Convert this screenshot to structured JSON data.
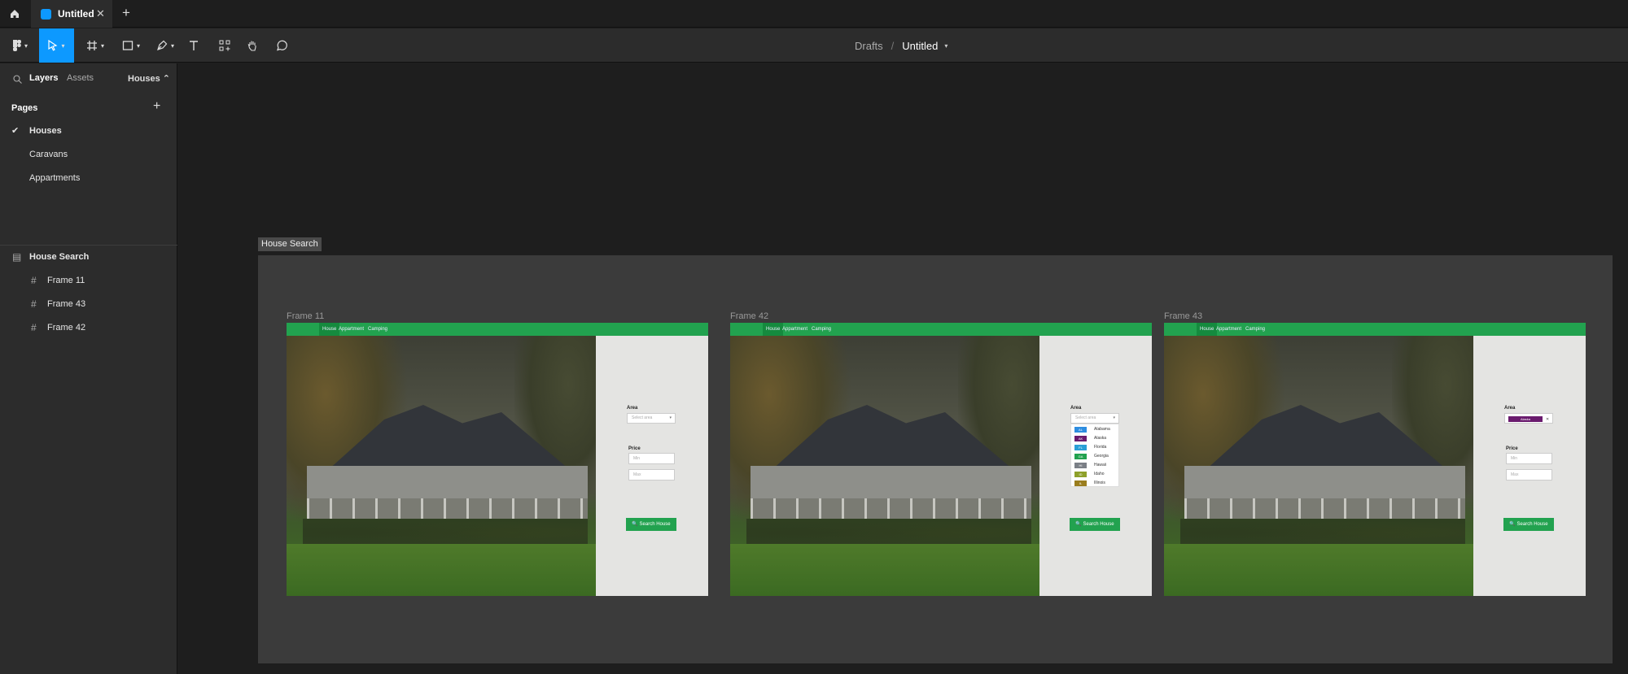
{
  "tabbar": {
    "tab_title": "Untitled",
    "close": "✕",
    "add": "+"
  },
  "toolbar": {
    "breadcrumb_root": "Drafts",
    "breadcrumb_sep": "/",
    "file_name": "Untitled"
  },
  "left_panel": {
    "tabs": {
      "layers": "Layers",
      "assets": "Assets",
      "page_switch": "Houses ⌃"
    },
    "pages_title": "Pages",
    "pages": [
      {
        "label": "Houses",
        "selected": true
      },
      {
        "label": "Caravans",
        "selected": false
      },
      {
        "label": "Appartments",
        "selected": false
      }
    ],
    "layers": [
      {
        "label": "House Search",
        "level": 0
      },
      {
        "label": "Frame 11",
        "level": 1
      },
      {
        "label": "Frame 43",
        "level": 1
      },
      {
        "label": "Frame 42",
        "level": 1
      }
    ]
  },
  "canvas": {
    "section_label": "House Search",
    "frames": [
      {
        "label": "Frame 11",
        "variant": "default"
      },
      {
        "label": "Frame 42",
        "variant": "dropdown"
      },
      {
        "label": "Frame 43",
        "variant": "selected"
      }
    ],
    "nav": [
      "House",
      "Appartment",
      "Camping"
    ],
    "form": {
      "area_label": "Area",
      "area_placeholder": "Select area",
      "price_label": "Price",
      "min_placeholder": "Min",
      "max_placeholder": "Max",
      "search_button": "🔍 Search House",
      "selected_area": "Alaska"
    },
    "area_options": [
      {
        "code": "AL",
        "name": "Alabama",
        "color": "#2d8de0"
      },
      {
        "code": "AK",
        "name": "Alaska",
        "color": "#6a1b6e"
      },
      {
        "code": "FL",
        "name": "Florida",
        "color": "#2a9fd6"
      },
      {
        "code": "GA",
        "name": "Georgia",
        "color": "#22a24f"
      },
      {
        "code": "HI",
        "name": "Hawaii",
        "color": "#7a7f86"
      },
      {
        "code": "ID",
        "name": "Idaho",
        "color": "#8ea02a"
      },
      {
        "code": "IL",
        "name": "Illinois",
        "color": "#9a7d1e"
      }
    ]
  }
}
